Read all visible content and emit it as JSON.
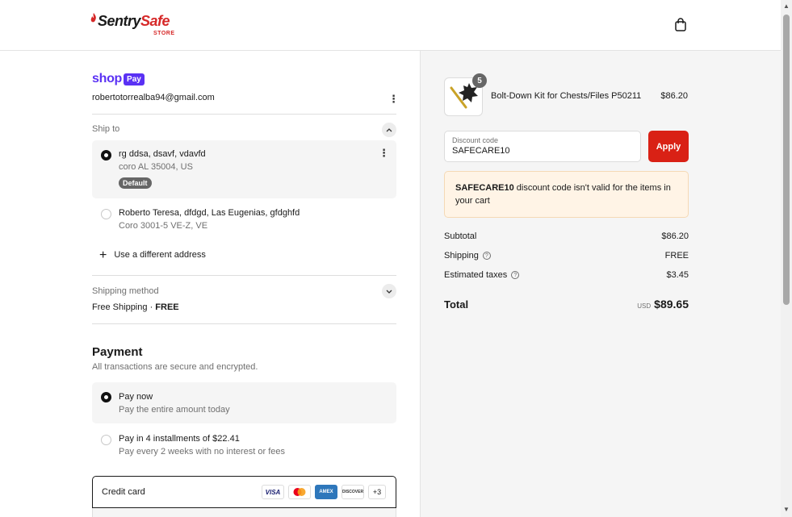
{
  "header": {
    "brand_part1": "Sentry",
    "brand_part2": "Safe",
    "brand_sub": "STORE",
    "cart_icon": "shopping-bag-icon"
  },
  "checkout": {
    "shop_pay": {
      "shop": "shop",
      "pay": "Pay"
    },
    "email": "robertotorrealba94@gmail.com",
    "ship_to": {
      "label": "Ship to",
      "addresses": [
        {
          "line1": "rg ddsa, dsavf, vdavfd",
          "line2": "coro AL 35004, US",
          "badge": "Default",
          "selected": true
        },
        {
          "line1": "Roberto Teresa, dfdgd, Las Eugenias, gfdghfd",
          "line2": "Coro 3001-5 VE-Z, VE",
          "selected": false
        }
      ],
      "use_different": "Use a different address"
    },
    "shipping_method": {
      "label": "Shipping method",
      "name": "Free Shipping",
      "sep": "·",
      "price": "FREE"
    },
    "payment": {
      "title": "Payment",
      "subtitle": "All transactions are secure and encrypted.",
      "options": [
        {
          "title": "Pay now",
          "desc": "Pay the entire amount today",
          "selected": true
        },
        {
          "title": "Pay in 4 installments of $22.41",
          "desc": "Pay every 2 weeks with no interest or fees",
          "selected": false
        }
      ],
      "credit_card_label": "Credit card",
      "cards": [
        "VISA",
        "mastercard",
        "AMEX",
        "DISCOVER"
      ],
      "more_cards": "+3"
    }
  },
  "summary": {
    "product": {
      "name": "Bolt-Down Kit for Chests/Files P50211",
      "price": "$86.20",
      "quantity": "5"
    },
    "discount": {
      "label": "Discount code",
      "value": "SAFECARE10",
      "apply": "Apply"
    },
    "error": {
      "code": "SAFECARE10",
      "message": " discount code isn't valid for the items in your cart"
    },
    "subtotal": {
      "label": "Subtotal",
      "value": "$86.20"
    },
    "shipping": {
      "label": "Shipping",
      "value": "FREE"
    },
    "taxes": {
      "label": "Estimated taxes",
      "value": "$3.45"
    },
    "total": {
      "label": "Total",
      "currency": "USD",
      "value": "$89.65"
    }
  },
  "colors": {
    "accent_red": "#d92115",
    "shop_purple": "#5a31f4",
    "error_bg": "#fff4e6"
  }
}
